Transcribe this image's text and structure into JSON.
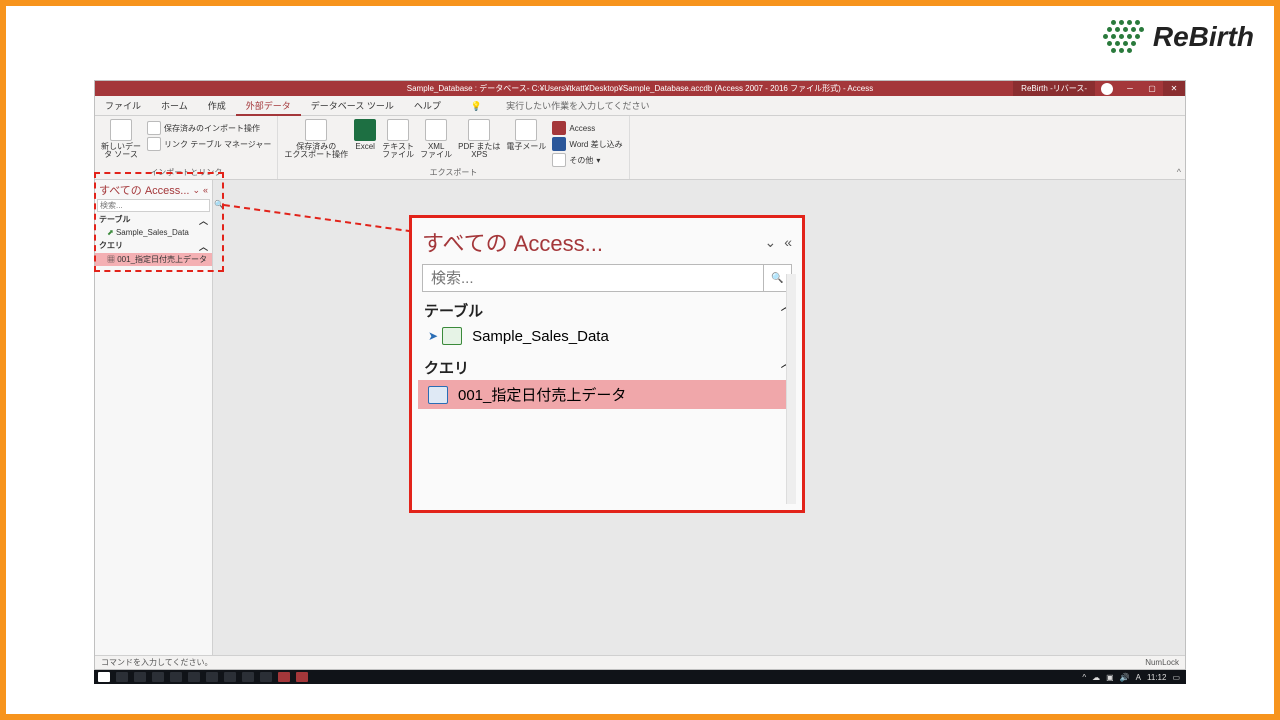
{
  "logo": {
    "text": "ReBirth"
  },
  "titlebar": {
    "center": "Sample_Database : データベース- C:¥Users¥tkatt¥Desktop¥Sample_Database.accdb (Access 2007 - 2016 ファイル形式) - Access",
    "user": "ReBirth -リバース-"
  },
  "tabs": {
    "file": "ファイル",
    "home": "ホーム",
    "create": "作成",
    "external": "外部データ",
    "dbtools": "データベース ツール",
    "help": "ヘルプ",
    "tellme": "実行したい作業を入力してください"
  },
  "ribbon": {
    "newsource": "新しいデー\nタ ソース",
    "savedimports": "保存済みのインポート操作",
    "linktable": "リンク テーブル マネージャー",
    "group1": "インポートとリンク",
    "savedexports": "保存済みの\nエクスポート操作",
    "excel": "Excel",
    "text": "テキスト\nファイル",
    "xml": "XML\nファイル",
    "pdf": "PDF または\nXPS",
    "email": "電子メール",
    "access": "Access",
    "wordmerge": "Word 差し込み",
    "other": "その他",
    "group2": "エクスポート"
  },
  "navpane": {
    "title": "すべての Access...",
    "search_placeholder": "検索...",
    "section_tables": "テーブル",
    "table_item": "Sample_Sales_Data",
    "section_queries": "クエリ",
    "query_item": "001_指定日付売上データ"
  },
  "zoom": {
    "title": "すべての Access...",
    "search_placeholder": "検索...",
    "section_tables": "テーブル",
    "table_item": "Sample_Sales_Data",
    "section_queries": "クエリ",
    "query_item": "001_指定日付売上データ"
  },
  "statusbar": {
    "left": "コマンドを入力してください。",
    "right": "NumLock"
  },
  "taskbar": {
    "time": "11:12"
  }
}
